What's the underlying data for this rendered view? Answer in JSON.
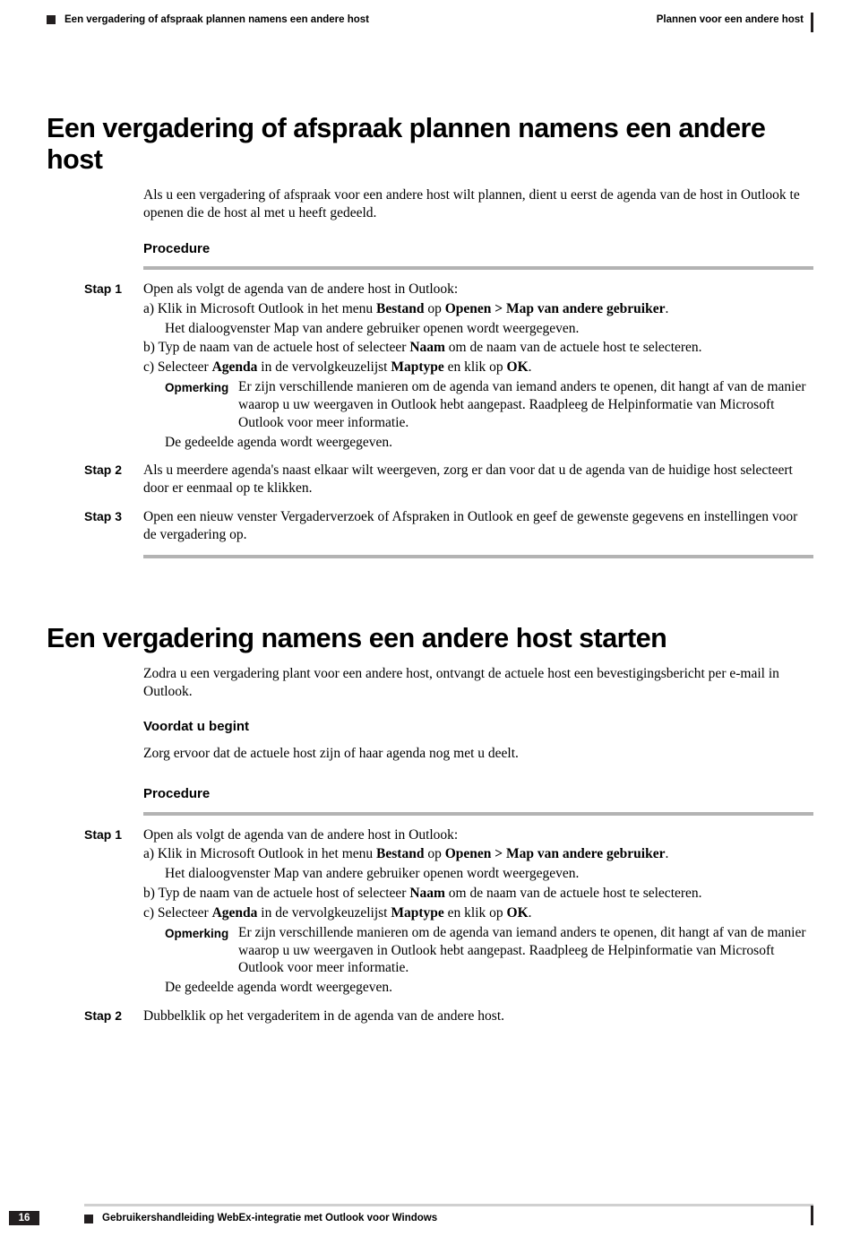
{
  "header": {
    "left": "Een vergadering of afspraak plannen namens een andere host",
    "right": "Plannen voor een andere host"
  },
  "section1": {
    "title": "Een vergadering of afspraak plannen namens een andere host",
    "intro": "Als u een vergadering of afspraak voor een andere host wilt plannen, dient u eerst de agenda van de host in Outlook te openen die de host al met u heeft gedeeld.",
    "procedure": "Procedure",
    "steps": {
      "s1": {
        "label": "Stap 1",
        "text": "Open als volgt de agenda van de andere host in Outlook:",
        "a_pre": "a)  Klik in Microsoft Outlook in het menu ",
        "a_b1": "Bestand",
        "a_mid": " op ",
        "a_b2": "Openen > Map van andere gebruiker",
        "a_post": ".",
        "a2": "Het dialoogvenster Map van andere gebruiker openen wordt weergegeven.",
        "b_pre": "b)  Typ de naam van de actuele host of selecteer ",
        "b_b1": "Naam",
        "b_post": " om de naam van de actuele host te selecteren.",
        "c_pre": "c)  Selecteer ",
        "c_b1": "Agenda",
        "c_mid1": " in de vervolgkeuzelijst ",
        "c_b2": "Maptype",
        "c_mid2": " en klik op ",
        "c_b3": "OK",
        "c_post": ".",
        "opm_label": "Opmerking",
        "opm_body": "Er zijn verschillende manieren om de agenda van iemand anders te openen, dit hangt af van de manier waarop u uw weergaven in Outlook hebt aangepast. Raadpleeg de Helpinformatie van Microsoft Outlook voor meer informatie.",
        "opm_after": "De gedeelde agenda wordt weergegeven."
      },
      "s2": {
        "label": "Stap 2",
        "text": "Als u meerdere agenda's naast elkaar wilt weergeven, zorg er dan voor dat u de agenda van de huidige host selecteert door er eenmaal op te klikken."
      },
      "s3": {
        "label": "Stap 3",
        "text": "Open een nieuw venster Vergaderverzoek of Afspraken in Outlook en geef de gewenste gegevens en instellingen voor de vergadering op."
      }
    }
  },
  "section2": {
    "title": "Een vergadering namens een andere host starten",
    "intro": "Zodra u een vergadering plant voor een andere host, ontvangt de actuele host een bevestigingsbericht per e-mail in Outlook.",
    "before_head": "Voordat u begint",
    "before_text": "Zorg ervoor dat de actuele host zijn of haar agenda nog met u deelt.",
    "procedure": "Procedure",
    "steps": {
      "s1": {
        "label": "Stap 1",
        "text": "Open als volgt de agenda van de andere host in Outlook:",
        "a_pre": "a)  Klik in Microsoft Outlook in het menu ",
        "a_b1": "Bestand",
        "a_mid": " op ",
        "a_b2": "Openen > Map van andere gebruiker",
        "a_post": ".",
        "a2": "Het dialoogvenster Map van andere gebruiker openen wordt weergegeven.",
        "b_pre": "b)  Typ de naam van de actuele host of selecteer ",
        "b_b1": "Naam",
        "b_post": " om de naam van de actuele host te selecteren.",
        "c_pre": "c)  Selecteer ",
        "c_b1": "Agenda",
        "c_mid1": " in de vervolgkeuzelijst ",
        "c_b2": "Maptype",
        "c_mid2": " en klik op ",
        "c_b3": "OK",
        "c_post": ".",
        "opm_label": "Opmerking",
        "opm_body": "Er zijn verschillende manieren om de agenda van iemand anders te openen, dit hangt af van de manier waarop u uw weergaven in Outlook hebt aangepast. Raadpleeg de Helpinformatie van Microsoft Outlook voor meer informatie.",
        "opm_after": "De gedeelde agenda wordt weergegeven."
      },
      "s2": {
        "label": "Stap 2",
        "text": "Dubbelklik op het vergaderitem in de agenda van de andere host."
      }
    }
  },
  "footer": {
    "title": "Gebruikershandleiding WebEx-integratie met Outlook voor Windows",
    "page": "16"
  }
}
